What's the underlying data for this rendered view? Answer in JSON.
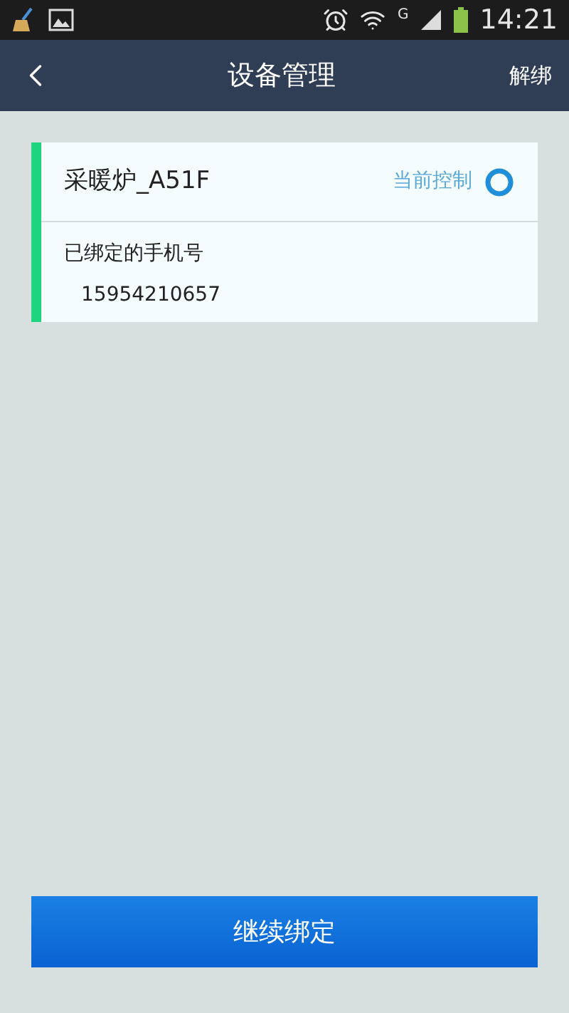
{
  "status_bar": {
    "network": "G",
    "time": "14:21"
  },
  "nav": {
    "title": "设备管理",
    "action": "解绑"
  },
  "devices": [
    {
      "name": "采暖炉_A51F",
      "status": "当前控制",
      "selected": true,
      "phone_label": "已绑定的手机号",
      "phone": "15954210657"
    }
  ],
  "button": "继续绑定"
}
